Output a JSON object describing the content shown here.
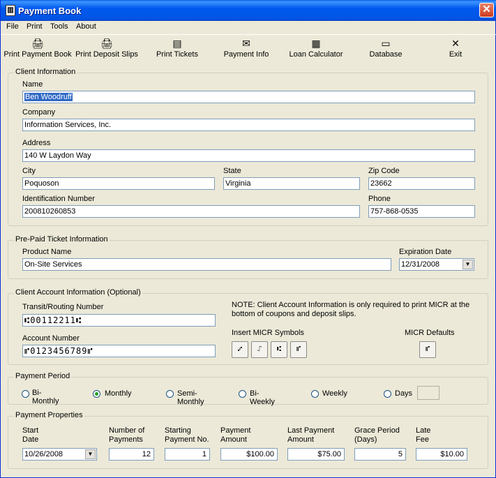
{
  "window": {
    "title": "Payment Book",
    "close_glyph": "✕"
  },
  "menu": [
    "File",
    "Print",
    "Tools",
    "About"
  ],
  "toolbar": [
    {
      "label": "Print Payment Book",
      "icon": "print-payment-book-icon",
      "glyph": "🖨"
    },
    {
      "label": "Print Deposit Slips",
      "icon": "print-deposit-slips-icon",
      "glyph": "🖨"
    },
    {
      "label": "Print Tickets",
      "icon": "print-tickets-icon",
      "glyph": "▤"
    },
    {
      "label": "Payment Info",
      "icon": "payment-info-icon",
      "glyph": "✉"
    },
    {
      "label": "Loan Calculator",
      "icon": "calculator-icon",
      "glyph": "▦"
    },
    {
      "label": "Database",
      "icon": "database-icon",
      "glyph": "▭"
    },
    {
      "label": "Exit",
      "icon": "exit-icon",
      "glyph": "✕"
    }
  ],
  "client": {
    "group_title": "Client Information",
    "name_label": "Name",
    "name": "Ben Woodruff",
    "company_label": "Company",
    "company": "Information Services, Inc.",
    "address_label": "Address",
    "address": "140 W Laydon Way",
    "city_label": "City",
    "city": "Poquoson",
    "state_label": "State",
    "state": "Virginia",
    "zip_label": "Zip Code",
    "zip": "23662",
    "id_label": "Identification Number",
    "id": "200810260853",
    "phone_label": "Phone",
    "phone": "757-868-0535"
  },
  "prepaid": {
    "group_title": "Pre-Paid Ticket Information",
    "product_label": "Product Name",
    "product": "On-Site Services",
    "exp_label": "Expiration Date",
    "exp": "12/31/2008"
  },
  "account": {
    "group_title": "Client Account Information (Optional)",
    "routing_label": "Transit/Routing Number",
    "routing": "⑆00112211⑆",
    "account_label": "Account Number",
    "account": "⑈0123456789⑈",
    "note": "NOTE:  Client Account Information is only required to print MICR at the bottom of coupons and deposit slips.",
    "insert_label": "Insert MICR Symbols",
    "symbols": [
      "⑇",
      "⑀",
      "⑆",
      "⑈"
    ],
    "defaults_label": "MICR Defaults",
    "default_symbol": "⑈"
  },
  "period": {
    "group_title": "Payment Period",
    "options": [
      "Bi-Monthly",
      "Monthly",
      "Semi-Monthly",
      "Bi-Weekly",
      "Weekly",
      "Days"
    ],
    "selected": "Monthly"
  },
  "properties": {
    "group_title": "Payment Properties",
    "start_label_1": "Start",
    "start_label_2": "Date",
    "start": "10/26/2008",
    "num_label_1": "Number of",
    "num_label_2": "Payments",
    "num": "12",
    "startno_label_1": "Starting",
    "startno_label_2": "Payment No.",
    "startno": "1",
    "amount_label_1": "Payment",
    "amount_label_2": "Amount",
    "amount": "$100.00",
    "last_label_1": "Last Payment",
    "last_label_2": "Amount",
    "last": "$75.00",
    "grace_label_1": "Grace Period",
    "grace_label_2": "(Days)",
    "grace": "5",
    "fee_label_1": "Late",
    "fee_label_2": "Fee",
    "fee": "$10.00"
  }
}
